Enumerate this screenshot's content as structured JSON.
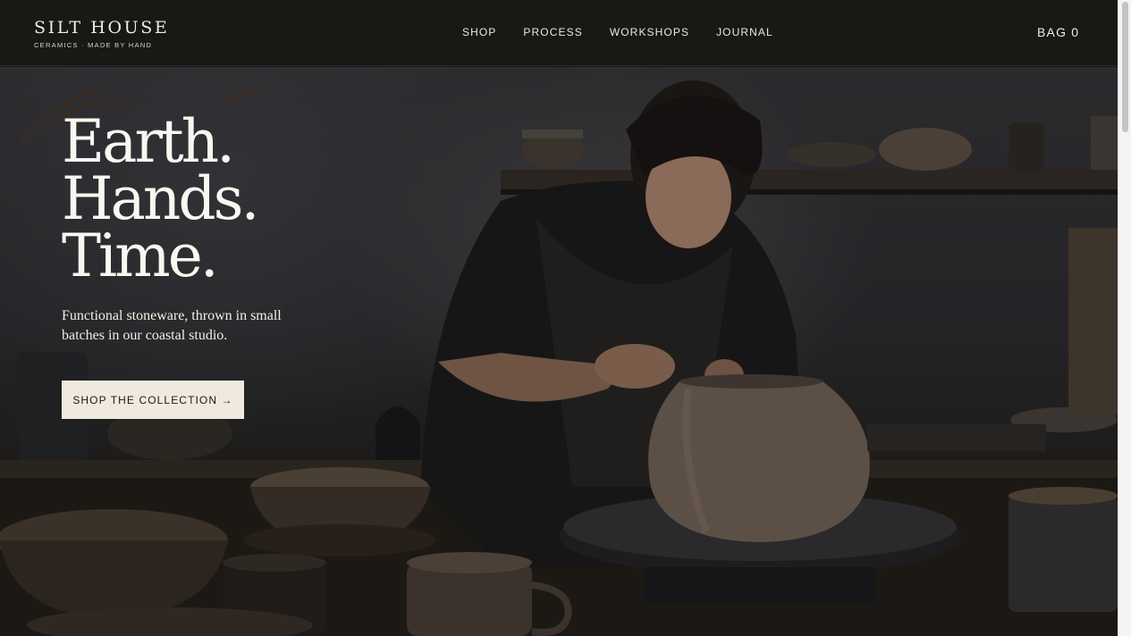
{
  "brand": {
    "name": "SILT HOUSE",
    "tagline": "CERAMICS · MADE BY HAND"
  },
  "nav": {
    "items": [
      "SHOP",
      "PROCESS",
      "WORKSHOPS",
      "JOURNAL"
    ]
  },
  "bag": {
    "label": "BAG 0"
  },
  "hero": {
    "headline": [
      "Earth.",
      "Hands.",
      "Time."
    ],
    "subcopy": "Functional stoneware, thrown in small batches in our coastal studio.",
    "cta_label": "SHOP THE COLLECTION →"
  },
  "colors": {
    "header_bg": "#181815",
    "cta_bg": "#efe9df",
    "text_light": "#faf7f1"
  }
}
